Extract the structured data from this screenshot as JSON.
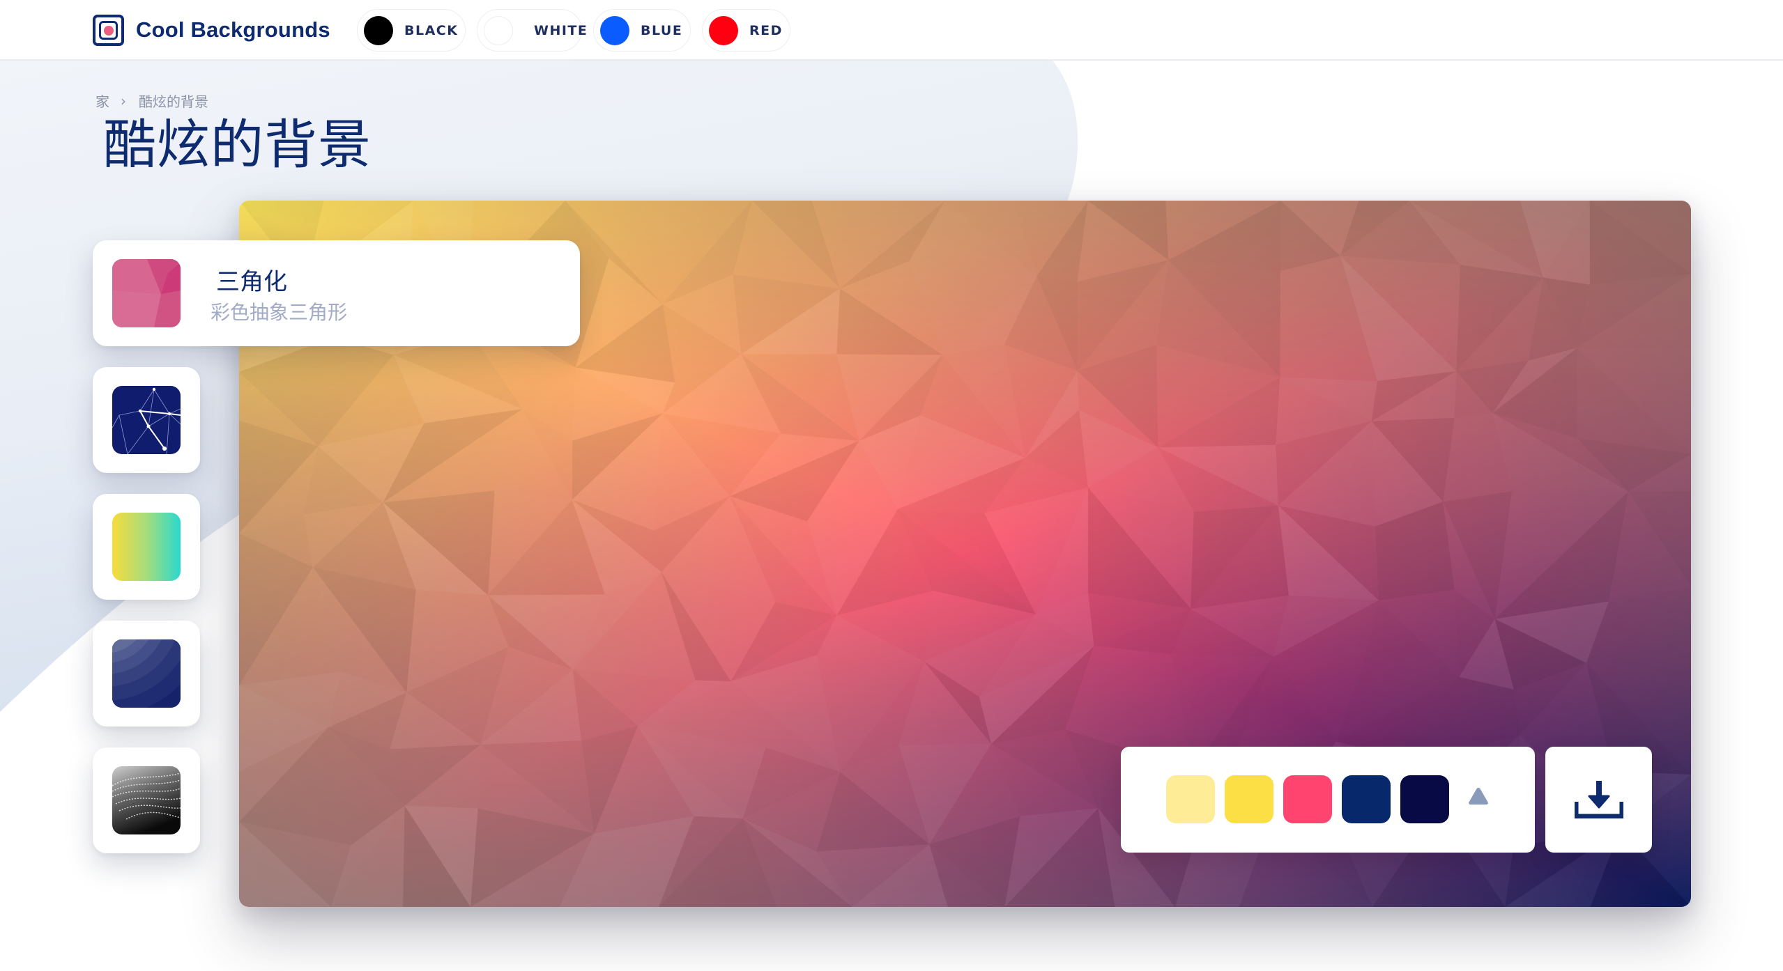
{
  "app": {
    "brand": "Cool Backgrounds",
    "accent_color": "#0d2b6e",
    "logo_dot_color": "#e95f7d"
  },
  "header": {
    "color_filters": [
      {
        "label": "BLACK",
        "color": "#000000"
      },
      {
        "label": "WHITE",
        "color": "#ffffff"
      },
      {
        "label": "BLUE",
        "color": "#0b5cff"
      },
      {
        "label": "RED",
        "color": "#ff0011"
      }
    ]
  },
  "breadcrumb": {
    "home": "家",
    "separator": "›",
    "current": "酷炫的背景"
  },
  "page": {
    "title": "酷炫的背景"
  },
  "sidebar": {
    "items": [
      {
        "name": "三角化",
        "description": "彩色抽象三角形",
        "thumbnail": "triangle-mosaic-pink",
        "active": true
      },
      {
        "name": "",
        "description": "",
        "thumbnail": "constellation-navy",
        "active": false
      },
      {
        "name": "",
        "description": "",
        "thumbnail": "gradient-yellow-teal",
        "active": false
      },
      {
        "name": "",
        "description": "",
        "thumbnail": "layered-waves-navy",
        "active": false
      },
      {
        "name": "",
        "description": "",
        "thumbnail": "monochrome-swirl",
        "active": false
      }
    ]
  },
  "preview": {
    "style": "triangulated-gradient",
    "gradient_stops": [
      "#f7e25a",
      "#fdb267",
      "#ff4f72",
      "#8a2f6e",
      "#0b1a5a"
    ]
  },
  "palette": {
    "colors": [
      "#feec96",
      "#fcde45",
      "#ff4470",
      "#08286c",
      "#070a45"
    ],
    "shape_icon": "triangle-icon",
    "shape_icon_color": "#8a9abb"
  },
  "actions": {
    "download_icon": "download-icon"
  }
}
